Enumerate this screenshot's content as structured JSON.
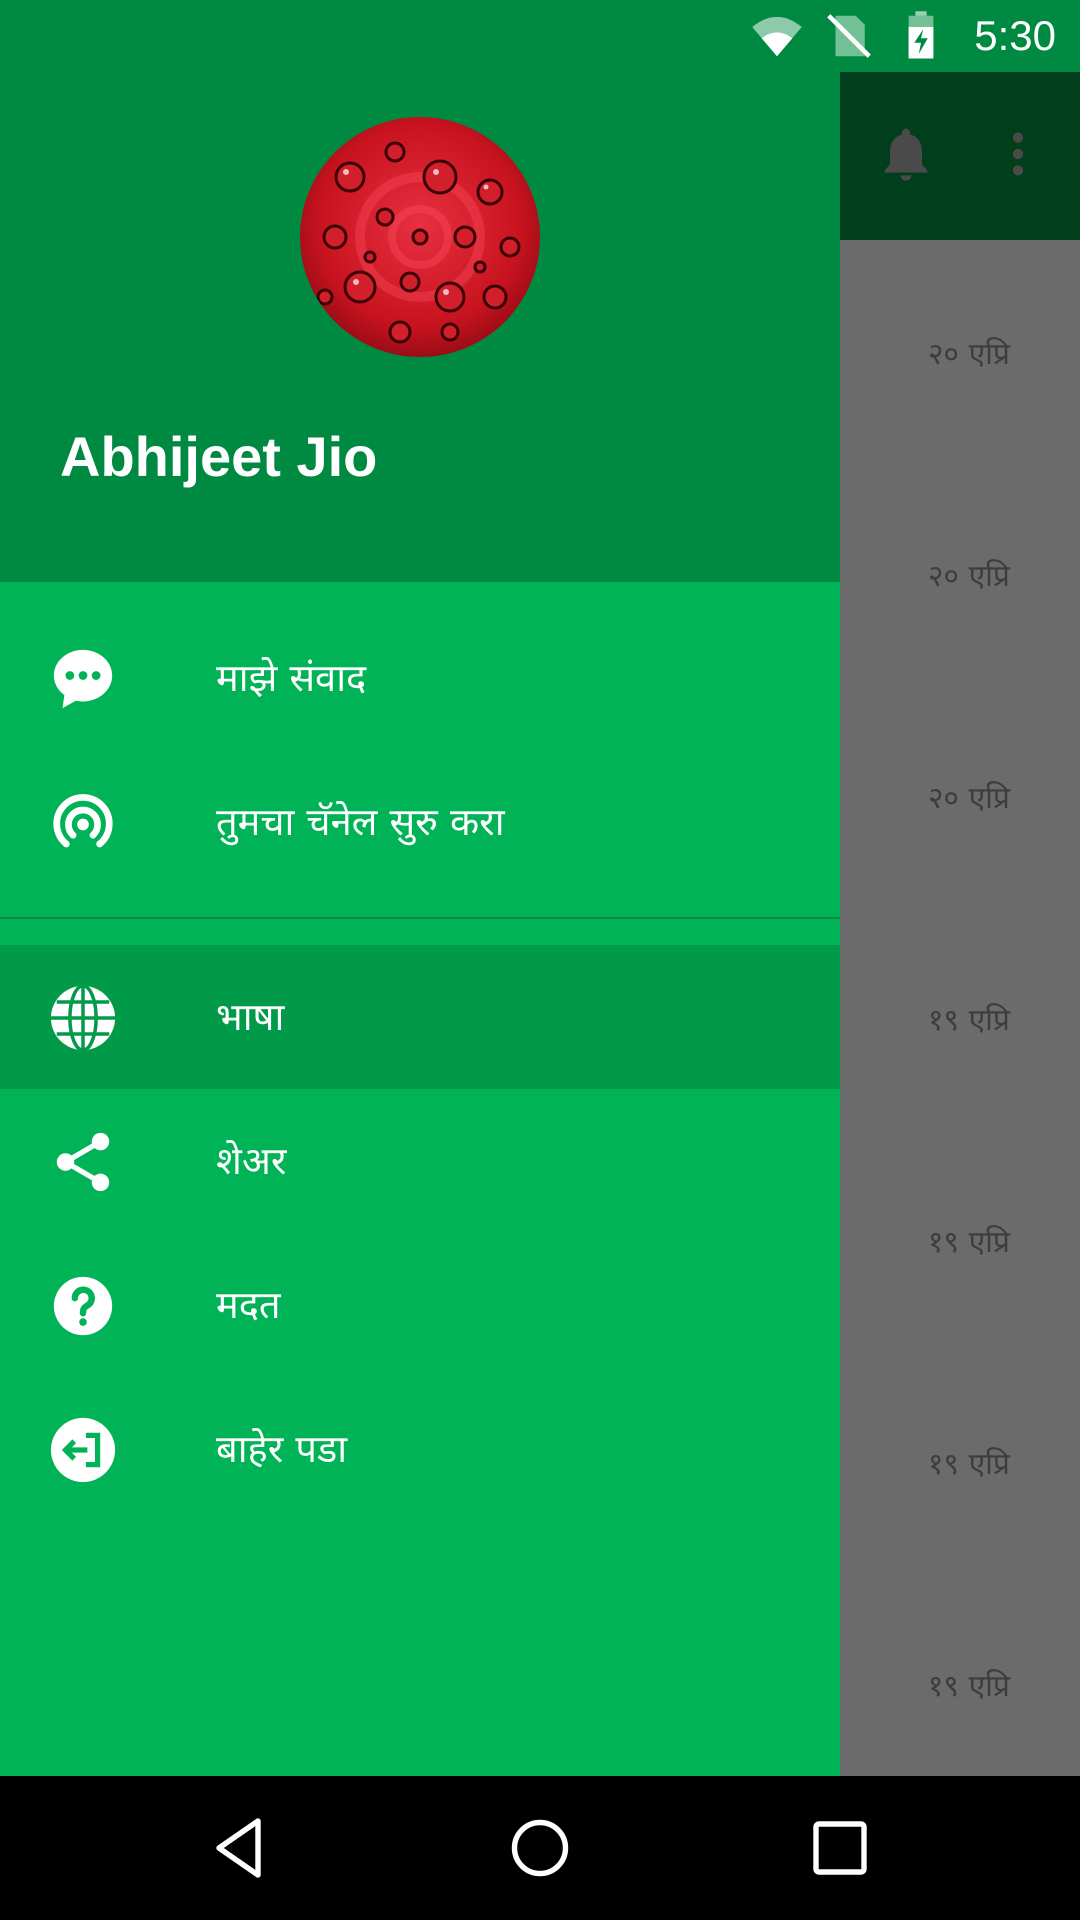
{
  "status_bar": {
    "time": "5:30",
    "icons": [
      "wifi-icon",
      "no-sim-icon",
      "battery-charging-icon"
    ]
  },
  "drawer": {
    "user_name": "Abhijeet Jio",
    "avatar": "avatar-red-water-drops",
    "items": [
      {
        "label": "माझे संवाद",
        "icon": "chat-bubble-icon"
      },
      {
        "label": "तुमचा चॅनेल सुरु करा",
        "icon": "broadcast-icon"
      },
      {
        "label": "भाषा",
        "icon": "globe-icon",
        "selected": true
      },
      {
        "label": "शेअर",
        "icon": "share-icon"
      },
      {
        "label": "मदत",
        "icon": "help-icon"
      },
      {
        "label": "बाहेर पडा",
        "icon": "logout-icon"
      }
    ]
  },
  "background": {
    "toolbar_icons": [
      "bell-icon",
      "more-vert-icon"
    ],
    "dates": [
      "२० एप्रि",
      "२० एप्रि",
      "२० एप्रि",
      "१९ एप्रि",
      "१९ एप्रि",
      "१९ एप्रि",
      "१९ एप्रि"
    ]
  },
  "colors": {
    "drawer_header": "#008a41",
    "drawer_body": "#00b356",
    "selected_item": "#019a49",
    "scrim": "#6b6b6b"
  }
}
